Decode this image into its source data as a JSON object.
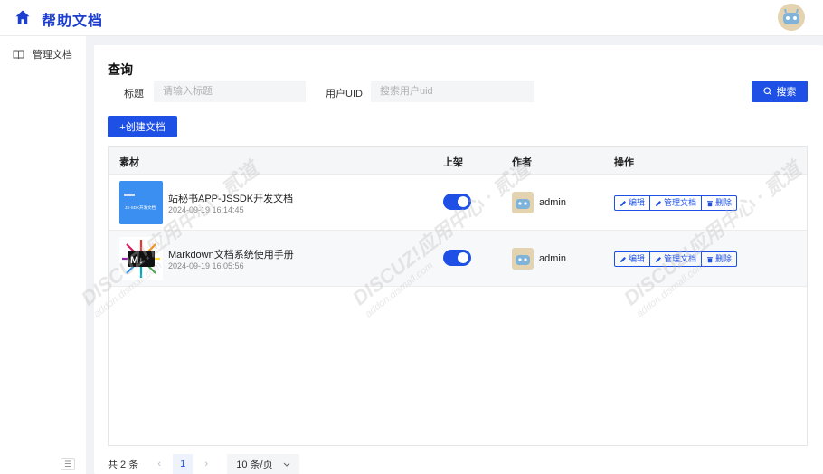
{
  "header": {
    "title": "帮助文档",
    "home_icon": "home-icon",
    "avatar_icon": "robot-avatar-icon"
  },
  "sidebar": {
    "items": [
      {
        "label": "管理文档",
        "icon": "book-open-icon"
      }
    ],
    "collapse_icon": "collapse-icon"
  },
  "query": {
    "title": "查询",
    "title_label": "标题",
    "title_placeholder": "请输入标题",
    "uid_label": "用户UID",
    "uid_placeholder": "搜索用户uid",
    "search_button": "搜索"
  },
  "create_button": "+创建文档",
  "table": {
    "headers": {
      "material": "素材",
      "listed": "上架",
      "author": "作者",
      "actions": "操作"
    },
    "rows": [
      {
        "title": "站秘书APP-JSSDK开发文档",
        "date": "2024-09-19 16:14:45",
        "thumb_caption": "JS-SDK开发文档",
        "listed": true,
        "author": "admin"
      },
      {
        "title": "Markdown文档系统使用手册",
        "date": "2024-09-19 16:05:56",
        "thumb_caption": "M↓",
        "listed": true,
        "author": "admin"
      }
    ],
    "actions": {
      "edit": "编辑",
      "manage": "管理文档",
      "delete": "删除"
    }
  },
  "pagination": {
    "total": "共 2 条",
    "current": "1",
    "page_size": "10 条/页"
  },
  "watermark": {
    "text": "DISCUZ!应用中心 · 贰道",
    "sub": "addon.dismall.com"
  },
  "colors": {
    "primary": "#1e50e6",
    "title": "#1d3fcf"
  }
}
